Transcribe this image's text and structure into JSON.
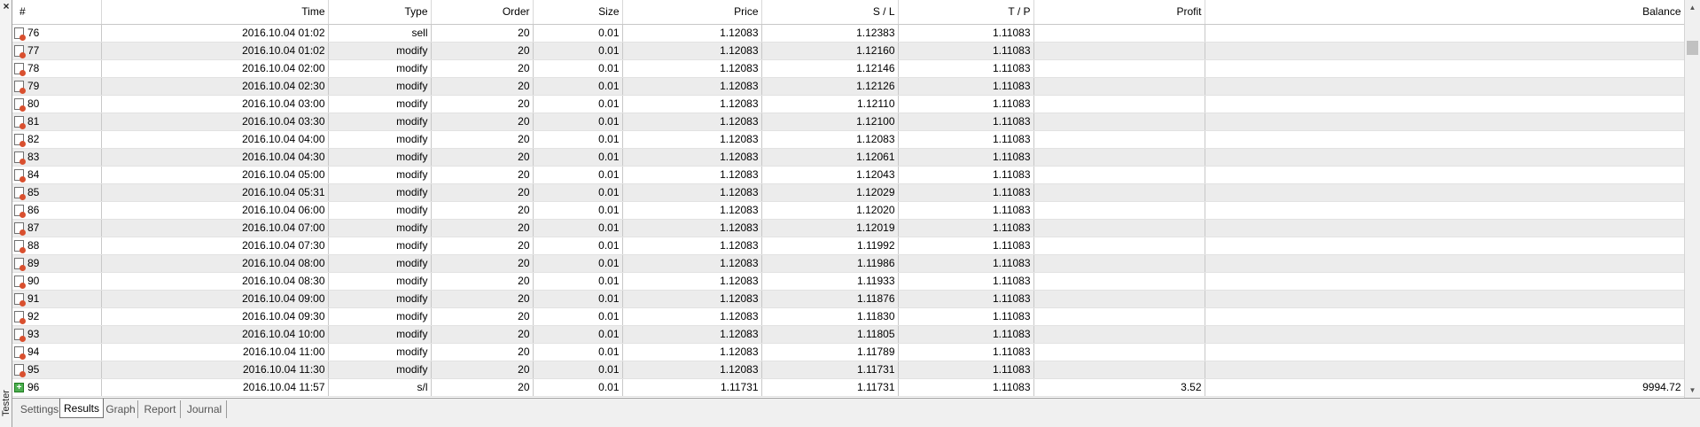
{
  "panel": {
    "side_label": "Tester",
    "close_symbol": "×"
  },
  "columns": [
    "#",
    "Time",
    "Type",
    "Order",
    "Size",
    "Price",
    "S / L",
    "T / P",
    "Profit",
    "Balance"
  ],
  "rows": [
    {
      "n": "76",
      "time": "2016.10.04 01:02",
      "type": "sell",
      "order": "20",
      "size": "0.01",
      "price": "1.12083",
      "sl": "1.12383",
      "tp": "1.11083",
      "profit": "",
      "balance": "",
      "icon": "order-icon"
    },
    {
      "n": "77",
      "time": "2016.10.04 01:02",
      "type": "modify",
      "order": "20",
      "size": "0.01",
      "price": "1.12083",
      "sl": "1.12160",
      "tp": "1.11083",
      "profit": "",
      "balance": "",
      "icon": "order-icon"
    },
    {
      "n": "78",
      "time": "2016.10.04 02:00",
      "type": "modify",
      "order": "20",
      "size": "0.01",
      "price": "1.12083",
      "sl": "1.12146",
      "tp": "1.11083",
      "profit": "",
      "balance": "",
      "icon": "order-icon"
    },
    {
      "n": "79",
      "time": "2016.10.04 02:30",
      "type": "modify",
      "order": "20",
      "size": "0.01",
      "price": "1.12083",
      "sl": "1.12126",
      "tp": "1.11083",
      "profit": "",
      "balance": "",
      "icon": "order-icon"
    },
    {
      "n": "80",
      "time": "2016.10.04 03:00",
      "type": "modify",
      "order": "20",
      "size": "0.01",
      "price": "1.12083",
      "sl": "1.12110",
      "tp": "1.11083",
      "profit": "",
      "balance": "",
      "icon": "order-icon"
    },
    {
      "n": "81",
      "time": "2016.10.04 03:30",
      "type": "modify",
      "order": "20",
      "size": "0.01",
      "price": "1.12083",
      "sl": "1.12100",
      "tp": "1.11083",
      "profit": "",
      "balance": "",
      "icon": "order-icon"
    },
    {
      "n": "82",
      "time": "2016.10.04 04:00",
      "type": "modify",
      "order": "20",
      "size": "0.01",
      "price": "1.12083",
      "sl": "1.12083",
      "tp": "1.11083",
      "profit": "",
      "balance": "",
      "icon": "order-icon"
    },
    {
      "n": "83",
      "time": "2016.10.04 04:30",
      "type": "modify",
      "order": "20",
      "size": "0.01",
      "price": "1.12083",
      "sl": "1.12061",
      "tp": "1.11083",
      "profit": "",
      "balance": "",
      "icon": "order-icon"
    },
    {
      "n": "84",
      "time": "2016.10.04 05:00",
      "type": "modify",
      "order": "20",
      "size": "0.01",
      "price": "1.12083",
      "sl": "1.12043",
      "tp": "1.11083",
      "profit": "",
      "balance": "",
      "icon": "order-icon"
    },
    {
      "n": "85",
      "time": "2016.10.04 05:31",
      "type": "modify",
      "order": "20",
      "size": "0.01",
      "price": "1.12083",
      "sl": "1.12029",
      "tp": "1.11083",
      "profit": "",
      "balance": "",
      "icon": "order-icon"
    },
    {
      "n": "86",
      "time": "2016.10.04 06:00",
      "type": "modify",
      "order": "20",
      "size": "0.01",
      "price": "1.12083",
      "sl": "1.12020",
      "tp": "1.11083",
      "profit": "",
      "balance": "",
      "icon": "order-icon"
    },
    {
      "n": "87",
      "time": "2016.10.04 07:00",
      "type": "modify",
      "order": "20",
      "size": "0.01",
      "price": "1.12083",
      "sl": "1.12019",
      "tp": "1.11083",
      "profit": "",
      "balance": "",
      "icon": "order-icon"
    },
    {
      "n": "88",
      "time": "2016.10.04 07:30",
      "type": "modify",
      "order": "20",
      "size": "0.01",
      "price": "1.12083",
      "sl": "1.11992",
      "tp": "1.11083",
      "profit": "",
      "balance": "",
      "icon": "order-icon"
    },
    {
      "n": "89",
      "time": "2016.10.04 08:00",
      "type": "modify",
      "order": "20",
      "size": "0.01",
      "price": "1.12083",
      "sl": "1.11986",
      "tp": "1.11083",
      "profit": "",
      "balance": "",
      "icon": "order-icon"
    },
    {
      "n": "90",
      "time": "2016.10.04 08:30",
      "type": "modify",
      "order": "20",
      "size": "0.01",
      "price": "1.12083",
      "sl": "1.11933",
      "tp": "1.11083",
      "profit": "",
      "balance": "",
      "icon": "order-icon"
    },
    {
      "n": "91",
      "time": "2016.10.04 09:00",
      "type": "modify",
      "order": "20",
      "size": "0.01",
      "price": "1.12083",
      "sl": "1.11876",
      "tp": "1.11083",
      "profit": "",
      "balance": "",
      "icon": "order-icon"
    },
    {
      "n": "92",
      "time": "2016.10.04 09:30",
      "type": "modify",
      "order": "20",
      "size": "0.01",
      "price": "1.12083",
      "sl": "1.11830",
      "tp": "1.11083",
      "profit": "",
      "balance": "",
      "icon": "order-icon"
    },
    {
      "n": "93",
      "time": "2016.10.04 10:00",
      "type": "modify",
      "order": "20",
      "size": "0.01",
      "price": "1.12083",
      "sl": "1.11805",
      "tp": "1.11083",
      "profit": "",
      "balance": "",
      "icon": "order-icon"
    },
    {
      "n": "94",
      "time": "2016.10.04 11:00",
      "type": "modify",
      "order": "20",
      "size": "0.01",
      "price": "1.12083",
      "sl": "1.11789",
      "tp": "1.11083",
      "profit": "",
      "balance": "",
      "icon": "order-icon"
    },
    {
      "n": "95",
      "time": "2016.10.04 11:30",
      "type": "modify",
      "order": "20",
      "size": "0.01",
      "price": "1.12083",
      "sl": "1.11731",
      "tp": "1.11083",
      "profit": "",
      "balance": "",
      "icon": "order-icon"
    },
    {
      "n": "96",
      "time": "2016.10.04 11:57",
      "type": "s/l",
      "order": "20",
      "size": "0.01",
      "price": "1.11731",
      "sl": "1.11731",
      "tp": "1.11083",
      "profit": "3.52",
      "balance": "9994.72",
      "icon": "balance-plus-icon"
    }
  ],
  "tabs": [
    {
      "label": "Settings",
      "active": false
    },
    {
      "label": "Results",
      "active": true
    },
    {
      "label": "Graph",
      "active": false
    },
    {
      "label": "Report",
      "active": false
    },
    {
      "label": "Journal",
      "active": false
    }
  ]
}
